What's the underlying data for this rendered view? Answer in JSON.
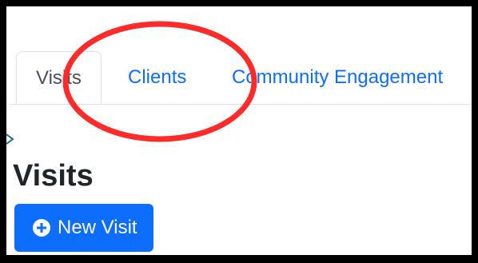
{
  "tabs": [
    {
      "label": "Visits",
      "active": true
    },
    {
      "label": "Clients",
      "active": false
    },
    {
      "label": "Community Engagement",
      "active": false
    }
  ],
  "page": {
    "title": "Visits"
  },
  "actions": {
    "new_visit_label": "New Visit"
  },
  "colors": {
    "primary": "#0d6efd",
    "annotation": "#ff2a2a",
    "tab_border": "#dee2e6"
  },
  "icons": {
    "new_visit": "plus-circle-icon",
    "edge": "arrow-right-icon"
  }
}
